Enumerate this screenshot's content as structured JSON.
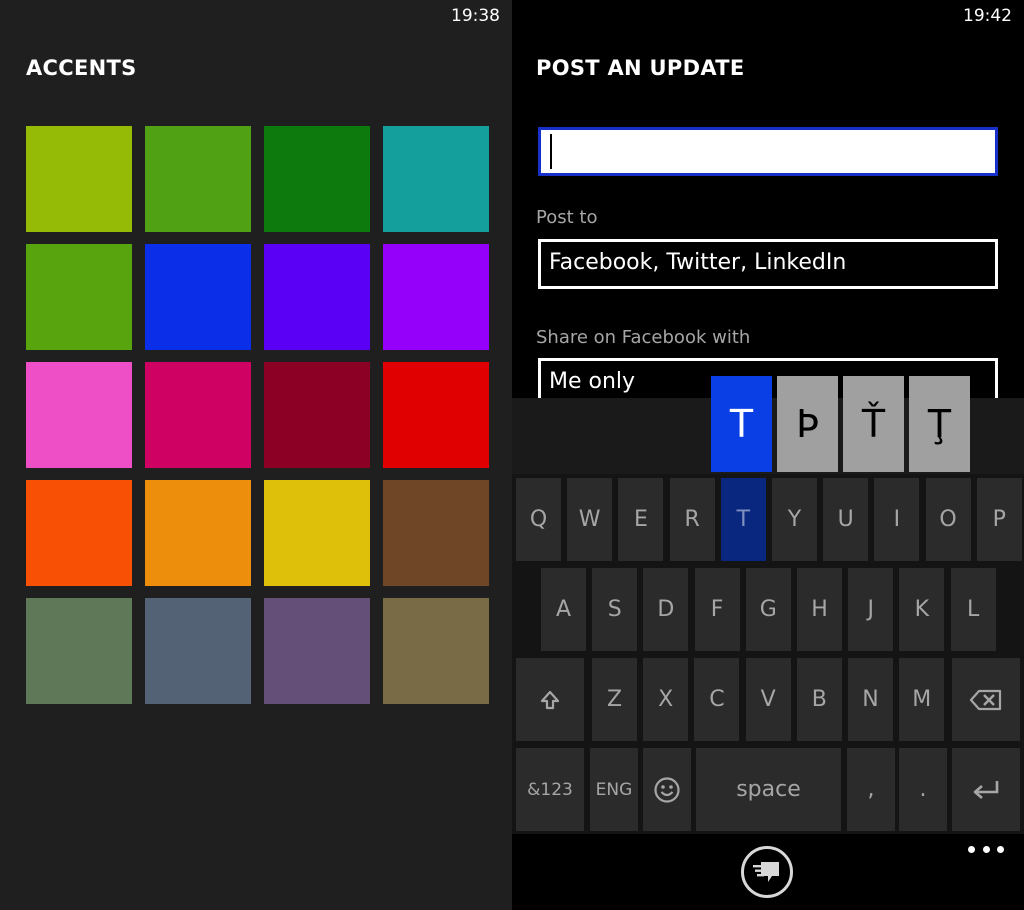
{
  "accents": {
    "clock": "19:38",
    "title": "ACCENTS",
    "swatches": [
      "#96bb06",
      "#51a115",
      "#0d7a0d",
      "#159f9c",
      "#57a40f",
      "#0b2ee8",
      "#5a00f5",
      "#9500fb",
      "#ef4fc6",
      "#cf0263",
      "#8b0024",
      "#e00002",
      "#f85005",
      "#ed8f0d",
      "#dec00a",
      "#6f4626",
      "#5f7958",
      "#546276",
      "#644f78",
      "#786b45"
    ]
  },
  "post": {
    "clock": "19:42",
    "title": "POST AN UPDATE",
    "update_value": "",
    "post_to_label": "Post to",
    "post_to_value": "Facebook, Twitter, LinkedIn",
    "share_label": "Share on Facebook with",
    "share_value": "Me only"
  },
  "keyboard": {
    "alternates": [
      "T",
      "Þ",
      "Ť",
      "Ţ"
    ],
    "row1": [
      "Q",
      "W",
      "E",
      "R",
      "T",
      "Y",
      "U",
      "I",
      "O",
      "P"
    ],
    "row2": [
      "A",
      "S",
      "D",
      "F",
      "G",
      "H",
      "J",
      "K",
      "L"
    ],
    "row3": [
      "Z",
      "X",
      "C",
      "V",
      "B",
      "N",
      "M"
    ],
    "sym_label": "&123",
    "lang_label": "ENG",
    "space_label": "space",
    "comma": ",",
    "period": "."
  },
  "icons": {
    "shift": "shift-icon",
    "backspace": "backspace-icon",
    "enter": "enter-icon",
    "emoji": "emoji-icon",
    "send": "send-message-icon",
    "more": "more-icon"
  }
}
